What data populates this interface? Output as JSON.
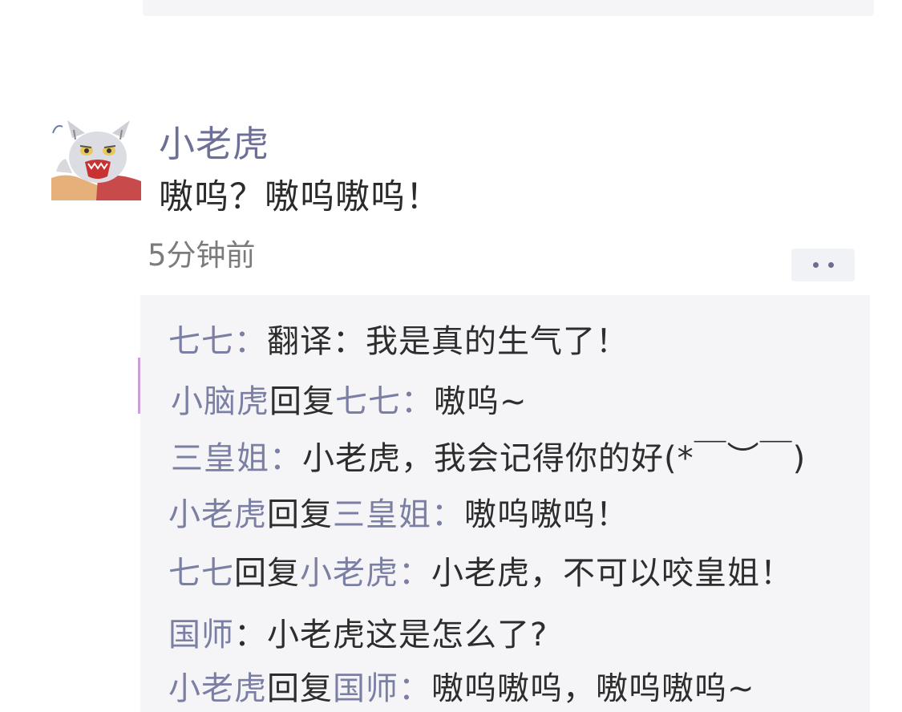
{
  "post": {
    "author": "小老虎",
    "content": "嗷呜？嗷呜嗷呜！",
    "time": "5分钟前",
    "avatar_icon": "tiger-cat-avatar",
    "more_icon": "more-dots-icon"
  },
  "comments": [
    {
      "from": "七七",
      "reply_word": "",
      "to": "",
      "sep": "：",
      "text": "翻译：我是真的生气了！"
    },
    {
      "from": "小脑虎",
      "reply_word": "回复",
      "to": "七七",
      "sep": "：",
      "text": "嗷呜~"
    },
    {
      "from": "三皇姐",
      "reply_word": "",
      "to": "",
      "sep": "：",
      "text": "小老虎，我会记得你的好(*￣︶￣)"
    },
    {
      "from": "小老虎",
      "reply_word": "回复",
      "to": "三皇姐",
      "sep": "：",
      "text": "嗷呜嗷呜！"
    },
    {
      "from": "七七",
      "reply_word": "回复",
      "to": "小老虎",
      "sep": "：",
      "text": "小老虎，不可以咬皇姐！"
    },
    {
      "from": "国师",
      "reply_word": "",
      "to": "",
      "sep": "：",
      "text": "小老虎这是怎么了?"
    },
    {
      "from": "小老虎",
      "reply_word": "回复",
      "to": "国师",
      "sep": "：",
      "text": "嗷呜嗷呜，嗷呜嗷呜~"
    }
  ],
  "colors": {
    "name": "#7b7fa3",
    "author": "#6d6f97",
    "text": "#2d2d2d",
    "panel": "#f5f5f7"
  }
}
